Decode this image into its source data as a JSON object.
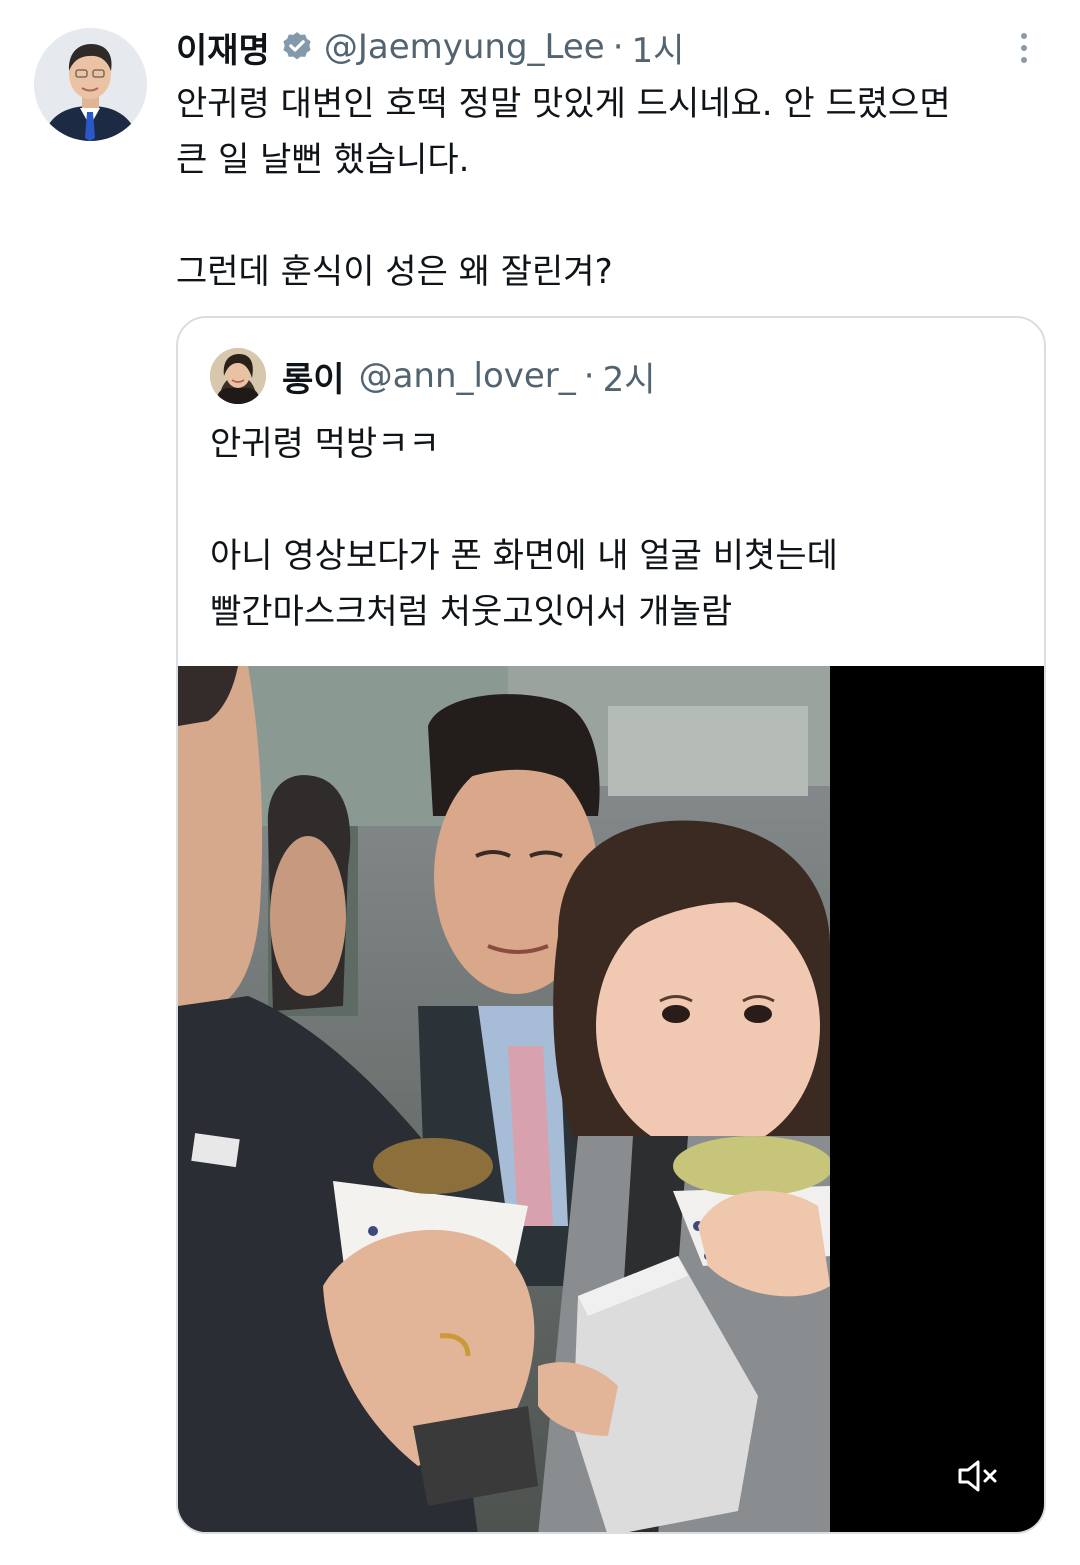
{
  "tweet": {
    "author_name": "이재명",
    "handle": "@Jaemyung_Lee",
    "separator": "·",
    "time": "1시",
    "text_lines": [
      "안귀령 대변인 호떡 정말 맛있게 드시네요. 안 드렸으면",
      "큰 일 날뻔 했습니다.",
      "그런데 훈식이 성은 왜 잘린겨?"
    ],
    "icons": {
      "verified": "verified-badge-icon",
      "more": "more-options-icon"
    }
  },
  "quoted_tweet": {
    "author_name": "롱이",
    "handle": "@ann_lover_",
    "separator": "·",
    "time": "2시",
    "text_lines": [
      "안귀령 먹방ㅋㅋ",
      "아니 영상보다가 폰 화면에 내 얼굴 비쳣는데",
      "빨간마스크처럼 처웃고잇어서 개놀람"
    ],
    "media": {
      "type": "video",
      "muted": true,
      "mute_icon": "speaker-muted-icon"
    }
  },
  "colors": {
    "text_primary": "#0f1419",
    "text_secondary": "#536471",
    "border": "#d9dee3",
    "verified_badge": "#829aab"
  }
}
